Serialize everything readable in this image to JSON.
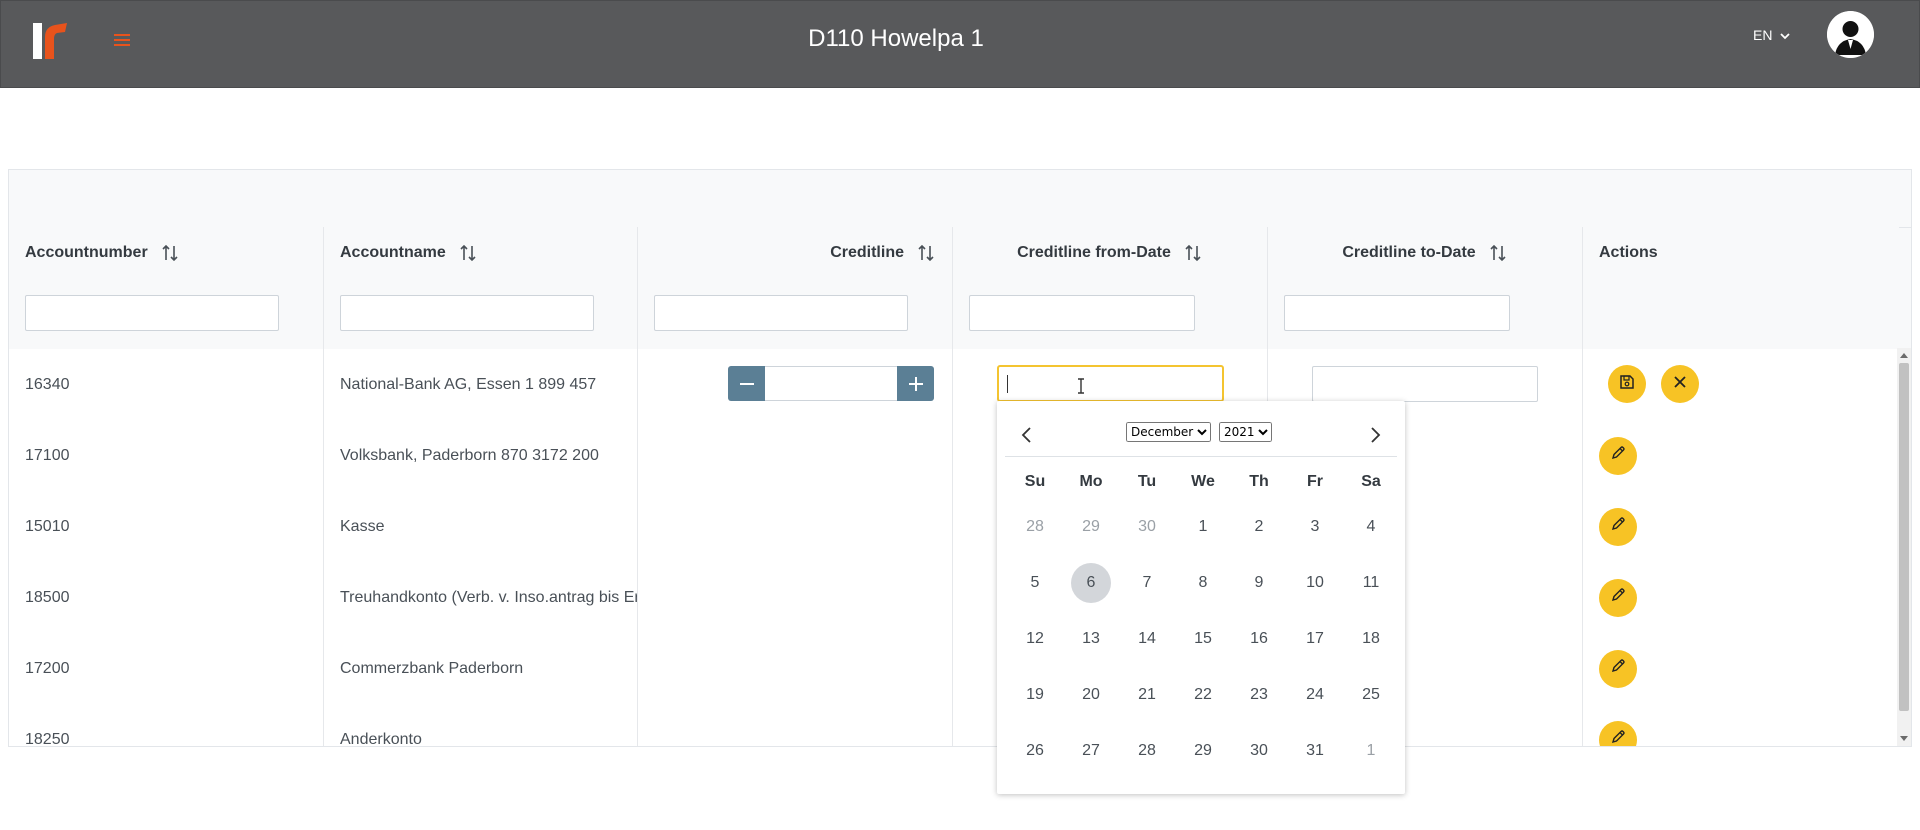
{
  "app": {
    "title": "D110 Howelpa 1",
    "language": "EN",
    "brand_color": "#e8531c",
    "header_bg": "#58595b"
  },
  "table": {
    "columns": [
      {
        "label": "Accountnumber",
        "sortable": true
      },
      {
        "label": "Accountname",
        "sortable": true
      },
      {
        "label": "Creditline",
        "sortable": true
      },
      {
        "label": "Creditline from-Date",
        "sortable": true
      },
      {
        "label": "Creditline to-Date",
        "sortable": true
      },
      {
        "label": "Actions",
        "sortable": false
      }
    ],
    "rows": [
      {
        "accountnumber": "16340",
        "accountname": "National-Bank AG, Essen 1 899 457",
        "editing": true
      },
      {
        "accountnumber": "17100",
        "accountname": "Volksbank, Paderborn 870 3172 200"
      },
      {
        "accountnumber": "15010",
        "accountname": "Kasse"
      },
      {
        "accountnumber": "18500",
        "accountname": "Treuhandkonto (Verb. v. Inso.antrag bis Er"
      },
      {
        "accountnumber": "17200",
        "accountname": "Commerzbank Paderborn"
      },
      {
        "accountnumber": "18250",
        "accountname": "Anderkonto"
      }
    ],
    "action_color": "#f7c325",
    "stepper_color": "#5b7f95"
  },
  "datepicker": {
    "month": "December",
    "year": "2021",
    "weekdays": [
      "Su",
      "Mo",
      "Tu",
      "We",
      "Th",
      "Fr",
      "Sa"
    ],
    "weeks": [
      [
        "28",
        "29",
        "30",
        "1",
        "2",
        "3",
        "4"
      ],
      [
        "5",
        "6",
        "7",
        "8",
        "9",
        "10",
        "11"
      ],
      [
        "12",
        "13",
        "14",
        "15",
        "16",
        "17",
        "18"
      ],
      [
        "19",
        "20",
        "21",
        "22",
        "23",
        "24",
        "25"
      ],
      [
        "26",
        "27",
        "28",
        "29",
        "30",
        "31",
        "1"
      ]
    ],
    "today": "6"
  }
}
